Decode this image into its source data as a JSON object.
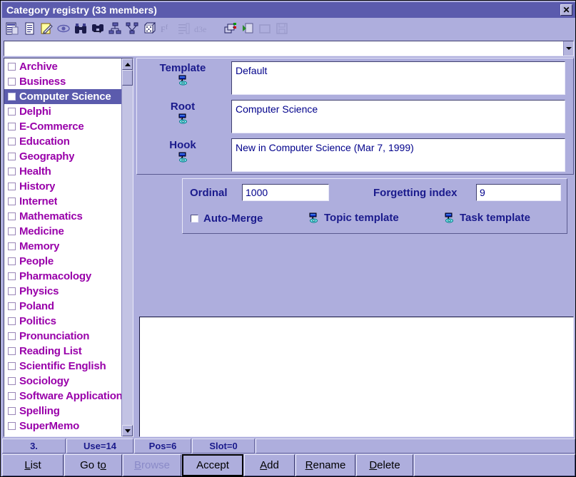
{
  "window": {
    "title": "Category registry (33 members)",
    "close_label": "✕"
  },
  "toolbar": {
    "icons": [
      {
        "name": "registry-list-icon",
        "label": "Registry"
      },
      {
        "name": "document-icon",
        "label": "Document"
      },
      {
        "name": "edit-note-icon",
        "label": "Edit"
      },
      {
        "name": "eye-icon",
        "label": "View"
      },
      {
        "name": "binoculars-icon",
        "label": "Search"
      },
      {
        "name": "binoculars-repeat-icon",
        "label": "Search again"
      },
      {
        "name": "tree-nodes-icon",
        "label": "Subset"
      },
      {
        "name": "tree-merge-icon",
        "label": "Merge"
      },
      {
        "name": "cube-icon",
        "label": "Neural"
      },
      {
        "name": "font-icon",
        "label": "Font"
      },
      {
        "name": "sort-list-icon",
        "label": "Sort"
      },
      {
        "name": "dsa-icon",
        "label": "Transcription"
      },
      {
        "name": "copy-windows-icon",
        "label": "Copy"
      },
      {
        "name": "paste-icon",
        "label": "Paste"
      },
      {
        "name": "window-icon",
        "label": "Window"
      },
      {
        "name": "save-disk-icon",
        "label": "Save"
      }
    ]
  },
  "search": {
    "value": "",
    "placeholder": ""
  },
  "list": {
    "selected_index": 2,
    "items": [
      {
        "label": "Archive",
        "checked": false
      },
      {
        "label": "Business",
        "checked": false
      },
      {
        "label": "Computer Science",
        "checked": false
      },
      {
        "label": "Delphi",
        "checked": false
      },
      {
        "label": "E-Commerce",
        "checked": false
      },
      {
        "label": "Education",
        "checked": false
      },
      {
        "label": "Geography",
        "checked": false
      },
      {
        "label": "Health",
        "checked": false
      },
      {
        "label": "History",
        "checked": false
      },
      {
        "label": "Internet",
        "checked": false
      },
      {
        "label": "Mathematics",
        "checked": false
      },
      {
        "label": "Medicine",
        "checked": false
      },
      {
        "label": "Memory",
        "checked": false
      },
      {
        "label": "People",
        "checked": false
      },
      {
        "label": "Pharmacology",
        "checked": false
      },
      {
        "label": "Physics",
        "checked": false
      },
      {
        "label": "Poland",
        "checked": false
      },
      {
        "label": "Politics",
        "checked": false
      },
      {
        "label": "Pronunciation",
        "checked": false
      },
      {
        "label": "Reading List",
        "checked": false
      },
      {
        "label": "Scientific English",
        "checked": false
      },
      {
        "label": "Sociology",
        "checked": false
      },
      {
        "label": "Software Application",
        "checked": false
      },
      {
        "label": "Spelling",
        "checked": false
      },
      {
        "label": "SuperMemo",
        "checked": false
      }
    ]
  },
  "links": {
    "template": {
      "label": "Template",
      "value": "Default",
      "icon": "template-link-icon"
    },
    "root": {
      "label": "Root",
      "value": "Computer Science",
      "icon": "root-link-icon"
    },
    "hook": {
      "label": "Hook",
      "value": "New in Computer Science (Mar 7, 1999)",
      "icon": "hook-link-icon"
    }
  },
  "properties": {
    "ordinal_label": "Ordinal",
    "ordinal_value": "1000",
    "forgetting_index_label": "Forgetting index",
    "forgetting_index_value": "9",
    "auto_merge_label": "Auto-Merge",
    "auto_merge_checked": false,
    "topic_template_label": "Topic template",
    "task_template_label": "Task template"
  },
  "status": {
    "cells": [
      {
        "name": "record-number",
        "text": "3."
      },
      {
        "name": "use-count",
        "text": "Use=14"
      },
      {
        "name": "position",
        "text": "Pos=6"
      },
      {
        "name": "slot",
        "text": "Slot=0"
      },
      {
        "name": "status-spacer",
        "text": ""
      }
    ]
  },
  "buttons": [
    {
      "name": "list-button",
      "accel": "L",
      "rest": "ist",
      "enabled": true,
      "default": false
    },
    {
      "name": "goto-button",
      "pre": "Go t",
      "accel": "o",
      "rest": "",
      "enabled": true,
      "default": false
    },
    {
      "name": "browse-button",
      "accel": "B",
      "rest": "rowse",
      "enabled": false,
      "default": false
    },
    {
      "name": "accept-button",
      "pre": "Accept",
      "accel": "",
      "rest": "",
      "enabled": true,
      "default": true
    },
    {
      "name": "add-button",
      "accel": "A",
      "rest": "dd",
      "enabled": true,
      "default": false
    },
    {
      "name": "rename-button",
      "accel": "R",
      "rest": "ename",
      "enabled": true,
      "default": false
    },
    {
      "name": "delete-button",
      "accel": "D",
      "rest": "elete",
      "enabled": true,
      "default": false
    }
  ],
  "colors": {
    "window_bg": "#aeaedd",
    "titlebar_bg": "#5b5bad",
    "list_text": "#9900aa",
    "selection_bg": "#5b5bad",
    "label_text": "#1a1a8c",
    "field_text": "#00008b"
  }
}
